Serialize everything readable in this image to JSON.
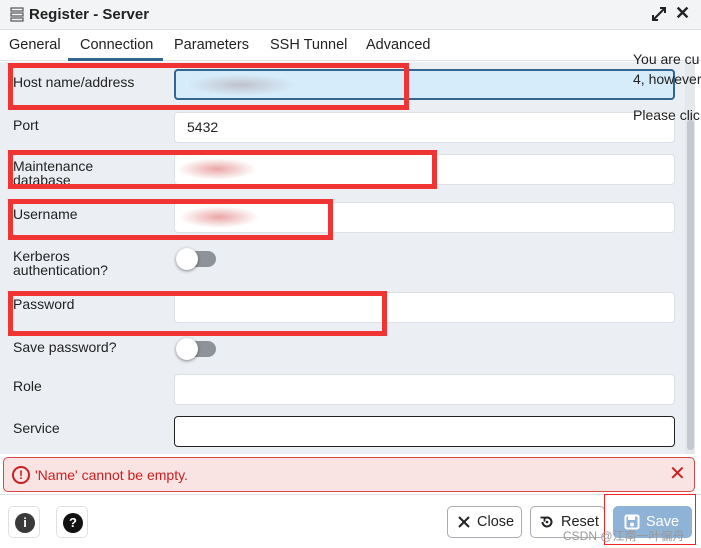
{
  "window": {
    "title": "Register - Server"
  },
  "tabs": [
    {
      "label": "General"
    },
    {
      "label": "Connection"
    },
    {
      "label": "Parameters"
    },
    {
      "label": "SSH Tunnel"
    },
    {
      "label": "Advanced"
    }
  ],
  "form": {
    "host_label": "Host name/address",
    "port_label": "Port",
    "port_value": "5432",
    "maintenance_db_label_line1": "Maintenance",
    "maintenance_db_label_line2": "database",
    "username_label": "Username",
    "kerberos_label_line1": "Kerberos",
    "kerberos_label_line2": "authentication?",
    "kerberos_enabled": false,
    "password_label": "Password",
    "save_password_label": "Save password?",
    "save_password_enabled": false,
    "role_label": "Role",
    "service_label": "Service"
  },
  "side_notice": {
    "line1": "You are cu",
    "line2": "4, however",
    "line3": "Please clic"
  },
  "error": {
    "message": "'Name' cannot be empty."
  },
  "footer": {
    "info_icon": "info-icon",
    "help_icon": "help-icon",
    "close_label": "Close",
    "reset_label": "Reset",
    "save_label": "Save"
  },
  "watermark": "CSDN @江南一叶偏舟",
  "colors": {
    "accent": "#326690",
    "error": "#c82020",
    "annotation_red": "#f03434",
    "save_button": "#8fb3d6"
  }
}
